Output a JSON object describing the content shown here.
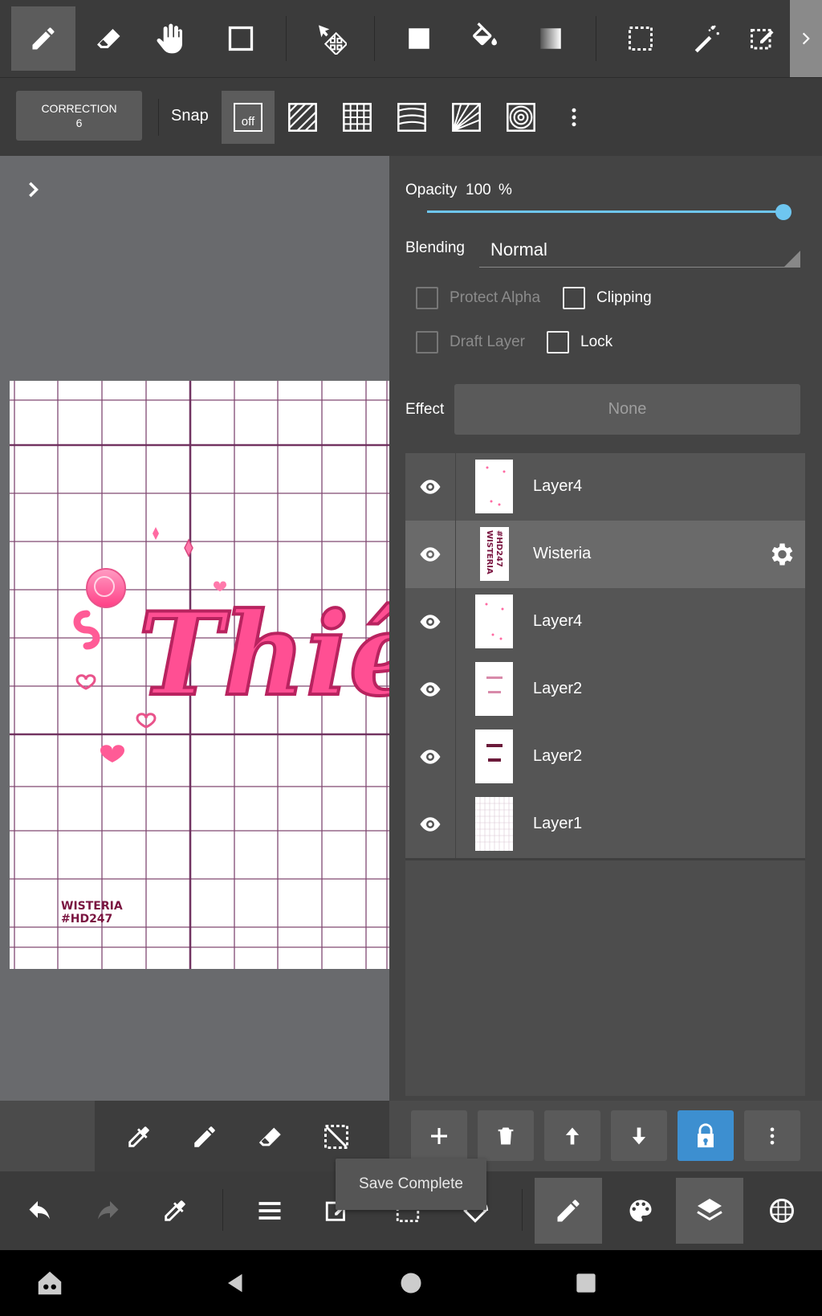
{
  "toolbar": {
    "tools": [
      "brush-tool",
      "eraser-tool",
      "hand-tool",
      "shape-tool",
      "transform-tool",
      "fill-rect-tool",
      "bucket-tool",
      "gradient-tool",
      "select-rect-tool",
      "magic-wand-tool",
      "select-pen-tool"
    ],
    "selected": "brush-tool"
  },
  "subbar": {
    "correction_label": "CORRECTION",
    "correction_value": "6",
    "snap_label": "Snap",
    "snap_off": "off"
  },
  "panel": {
    "opacity_label": "Opacity",
    "opacity_value": "100",
    "opacity_unit": "%",
    "opacity_fraction": 1.0,
    "blending_label": "Blending",
    "blending_value": "Normal",
    "protect_alpha": "Protect Alpha",
    "clipping": "Clipping",
    "draft_layer": "Draft Layer",
    "lock": "Lock",
    "effect_label": "Effect",
    "effect_value": "None"
  },
  "layers": [
    {
      "name": "Layer4",
      "selected": false
    },
    {
      "name": "Wisteria",
      "selected": true
    },
    {
      "name": "Layer4",
      "selected": false
    },
    {
      "name": "Layer2",
      "selected": false
    },
    {
      "name": "Layer2",
      "selected": false
    },
    {
      "name": "Layer1",
      "selected": false
    }
  ],
  "canvas": {
    "headline": "Thiê",
    "watermark_line1": "WISTERIA",
    "watermark_line2": "#HD247"
  },
  "toast": "Save Complete",
  "colors": {
    "accent_blue": "#3d8fd0",
    "slider": "#6ec6f0",
    "pink": "#ff4f93",
    "grid": "#6b2a5a"
  }
}
